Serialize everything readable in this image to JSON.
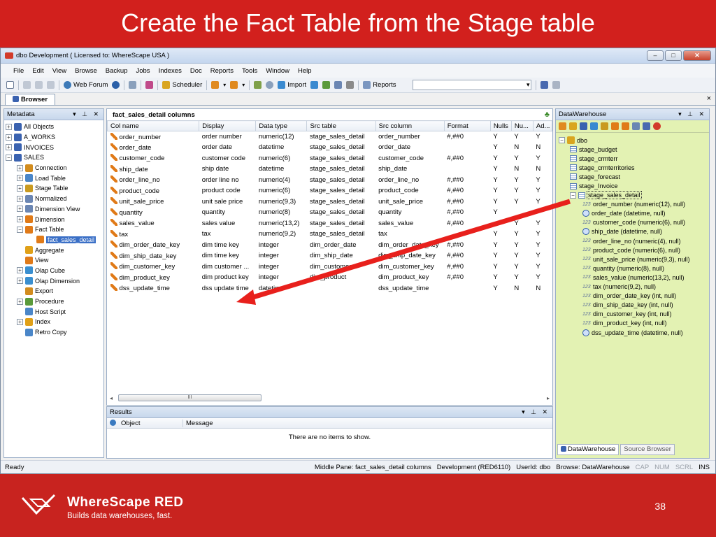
{
  "slide": {
    "title": "Create the Fact Table from the Stage table",
    "page": "38"
  },
  "app": {
    "title": "dbo  Development  ( Licensed to: WhereScape USA )",
    "menu": [
      "File",
      "Edit",
      "View",
      "Browse",
      "Backup",
      "Jobs",
      "Indexes",
      "Doc",
      "Reports",
      "Tools",
      "Window",
      "Help"
    ],
    "toolbar": {
      "web_forum": "Web Forum",
      "scheduler": "Scheduler",
      "import": "Import",
      "reports_label": "Reports"
    },
    "browser_tab": "Browser"
  },
  "metadata": {
    "header": "Metadata",
    "items": [
      {
        "label": "All Objects",
        "pm": "+",
        "indent": 0,
        "color": "#3a62b0"
      },
      {
        "label": "A_WORKS",
        "pm": "+",
        "indent": 0,
        "color": "#3a62b0"
      },
      {
        "label": "INVOICES",
        "pm": "+",
        "indent": 0,
        "color": "#3a62b0"
      },
      {
        "label": "SALES",
        "pm": "−",
        "indent": 0,
        "color": "#3a62b0"
      },
      {
        "label": "Connection",
        "pm": "+",
        "indent": 1,
        "color": "#d28c1e"
      },
      {
        "label": "Load Table",
        "pm": "+",
        "indent": 1,
        "color": "#4a86c8"
      },
      {
        "label": "Stage Table",
        "pm": "+",
        "indent": 1,
        "color": "#c99a20"
      },
      {
        "label": "Normalized",
        "pm": "+",
        "indent": 1,
        "color": "#6b86b3"
      },
      {
        "label": "Dimension View",
        "pm": "+",
        "indent": 1,
        "color": "#6b86b3"
      },
      {
        "label": "Dimension",
        "pm": "+",
        "indent": 1,
        "color": "#e07a18"
      },
      {
        "label": "Fact Table",
        "pm": "−",
        "indent": 1,
        "color": "#e07a18"
      },
      {
        "label": "fact_sales_detail",
        "pm": "",
        "indent": 2,
        "color": "#e07a18",
        "selected": true
      },
      {
        "label": "Aggregate",
        "pm": "",
        "indent": 1,
        "color": "#e0a018"
      },
      {
        "label": "View",
        "pm": "",
        "indent": 1,
        "color": "#e07a18"
      },
      {
        "label": "Olap Cube",
        "pm": "+",
        "indent": 1,
        "color": "#3a8fd0"
      },
      {
        "label": "Olap Dimension",
        "pm": "+",
        "indent": 1,
        "color": "#3a8fd0"
      },
      {
        "label": "Export",
        "pm": "",
        "indent": 1,
        "color": "#d28c1e"
      },
      {
        "label": "Procedure",
        "pm": "+",
        "indent": 1,
        "color": "#5a9a3a"
      },
      {
        "label": "Host Script",
        "pm": "",
        "indent": 1,
        "color": "#4a86c8"
      },
      {
        "label": "Index",
        "pm": "+",
        "indent": 1,
        "color": "#e0a018"
      },
      {
        "label": "Retro Copy",
        "pm": "",
        "indent": 1,
        "color": "#4a86c8"
      }
    ]
  },
  "middle": {
    "header": "fact_sales_detail columns",
    "columns": [
      "Col name",
      "Display",
      "Data type",
      "Src table",
      "Src column",
      "Format",
      "Nulls",
      "Nu...",
      "Ad..."
    ],
    "rows": [
      [
        "order_number",
        "order number",
        "numeric(12)",
        "stage_sales_detail",
        "order_number",
        "#,##0",
        "Y",
        "Y",
        "Y"
      ],
      [
        "order_date",
        "order date",
        "datetime",
        "stage_sales_detail",
        "order_date",
        "",
        "Y",
        "N",
        "N"
      ],
      [
        "customer_code",
        "customer code",
        "numeric(6)",
        "stage_sales_detail",
        "customer_code",
        "#,##0",
        "Y",
        "Y",
        "Y"
      ],
      [
        "ship_date",
        "ship date",
        "datetime",
        "stage_sales_detail",
        "ship_date",
        "",
        "Y",
        "N",
        "N"
      ],
      [
        "order_line_no",
        "order line no",
        "numeric(4)",
        "stage_sales_detail",
        "order_line_no",
        "#,##0",
        "Y",
        "Y",
        "Y"
      ],
      [
        "product_code",
        "product code",
        "numeric(6)",
        "stage_sales_detail",
        "product_code",
        "#,##0",
        "Y",
        "Y",
        "Y"
      ],
      [
        "unit_sale_price",
        "unit sale price",
        "numeric(9,3)",
        "stage_sales_detail",
        "unit_sale_price",
        "#,##0",
        "Y",
        "Y",
        "Y"
      ],
      [
        "quantity",
        "quantity",
        "numeric(8)",
        "stage_sales_detail",
        "quantity",
        "#,##0",
        "Y",
        "",
        ""
      ],
      [
        "sales_value",
        "sales value",
        "numeric(13,2)",
        "stage_sales_detail",
        "sales_value",
        "#,##0",
        "",
        "Y",
        "Y"
      ],
      [
        "tax",
        "tax",
        "numeric(9,2)",
        "stage_sales_detail",
        "tax",
        "",
        "Y",
        "Y",
        "Y"
      ],
      [
        "dim_order_date_key",
        "dim time key",
        "integer",
        "dim_order_date",
        "dim_order_date_key",
        "#,##0",
        "Y",
        "Y",
        "Y"
      ],
      [
        "dim_ship_date_key",
        "dim time key",
        "integer",
        "dim_ship_date",
        "dim_ship_date_key",
        "#,##0",
        "Y",
        "Y",
        "Y"
      ],
      [
        "dim_customer_key",
        "dim customer ...",
        "integer",
        "dim_customer",
        "dim_customer_key",
        "#,##0",
        "Y",
        "Y",
        "Y"
      ],
      [
        "dim_product_key",
        "dim product key",
        "integer",
        "dim_product",
        "dim_product_key",
        "#,##0",
        "Y",
        "Y",
        "Y"
      ],
      [
        "dss_update_time",
        "dss update time",
        "datetime",
        "",
        "dss_update_time",
        "",
        "Y",
        "N",
        "N"
      ]
    ],
    "scroll_thumb": "III"
  },
  "results": {
    "header": "Results",
    "col_object": "Object",
    "col_message": "Message",
    "empty": "There are no items to show."
  },
  "datawarehouse": {
    "header": "DataWarehouse",
    "root": "dbo",
    "tables": [
      "stage_budget",
      "stage_crmterr",
      "stage_crmterritories",
      "stage_forecast",
      "stage_Invoice"
    ],
    "selected_table": "stage_sales_detail",
    "columns": [
      {
        "label": "order_number  (numeric(12), null)",
        "kind": "num"
      },
      {
        "label": "order_date  (datetime, null)",
        "kind": "date"
      },
      {
        "label": "customer_code  (numeric(6), null)",
        "kind": "num"
      },
      {
        "label": "ship_date  (datetime, null)",
        "kind": "date"
      },
      {
        "label": "order_line_no  (numeric(4), null)",
        "kind": "num"
      },
      {
        "label": "product_code  (numeric(6), null)",
        "kind": "num"
      },
      {
        "label": "unit_sale_price  (numeric(9,3), null)",
        "kind": "num"
      },
      {
        "label": "quantity  (numeric(8), null)",
        "kind": "num"
      },
      {
        "label": "sales_value  (numeric(13,2), null)",
        "kind": "num"
      },
      {
        "label": "tax  (numeric(9,2), null)",
        "kind": "num"
      },
      {
        "label": "dim_order_date_key  (int, null)",
        "kind": "num"
      },
      {
        "label": "dim_ship_date_key  (int, null)",
        "kind": "num"
      },
      {
        "label": "dim_customer_key  (int, null)",
        "kind": "num"
      },
      {
        "label": "dim_product_key  (int, null)",
        "kind": "num"
      },
      {
        "label": "dss_update_time  (datetime, null)",
        "kind": "date"
      }
    ],
    "num_icon": "123",
    "tab_active": "DataWarehouse",
    "tab_inactive": "Source Browser"
  },
  "status": {
    "left": "Ready",
    "middle_pane": "Middle Pane: fact_sales_detail columns",
    "env": "Development (RED6110)",
    "user": "UserId: dbo",
    "browse": "Browse: DataWarehouse",
    "cap": "CAP",
    "num": "NUM",
    "scrl": "SCRL",
    "ins": "INS"
  },
  "footer": {
    "brand": "WhereScape RED",
    "tagline": "Builds data warehouses, fast."
  },
  "colors": {
    "slide_red": "#c8231f",
    "arrow_red": "#e8201c",
    "dw_panel": "#e3f2b3",
    "selection": "#3a6fc6"
  }
}
